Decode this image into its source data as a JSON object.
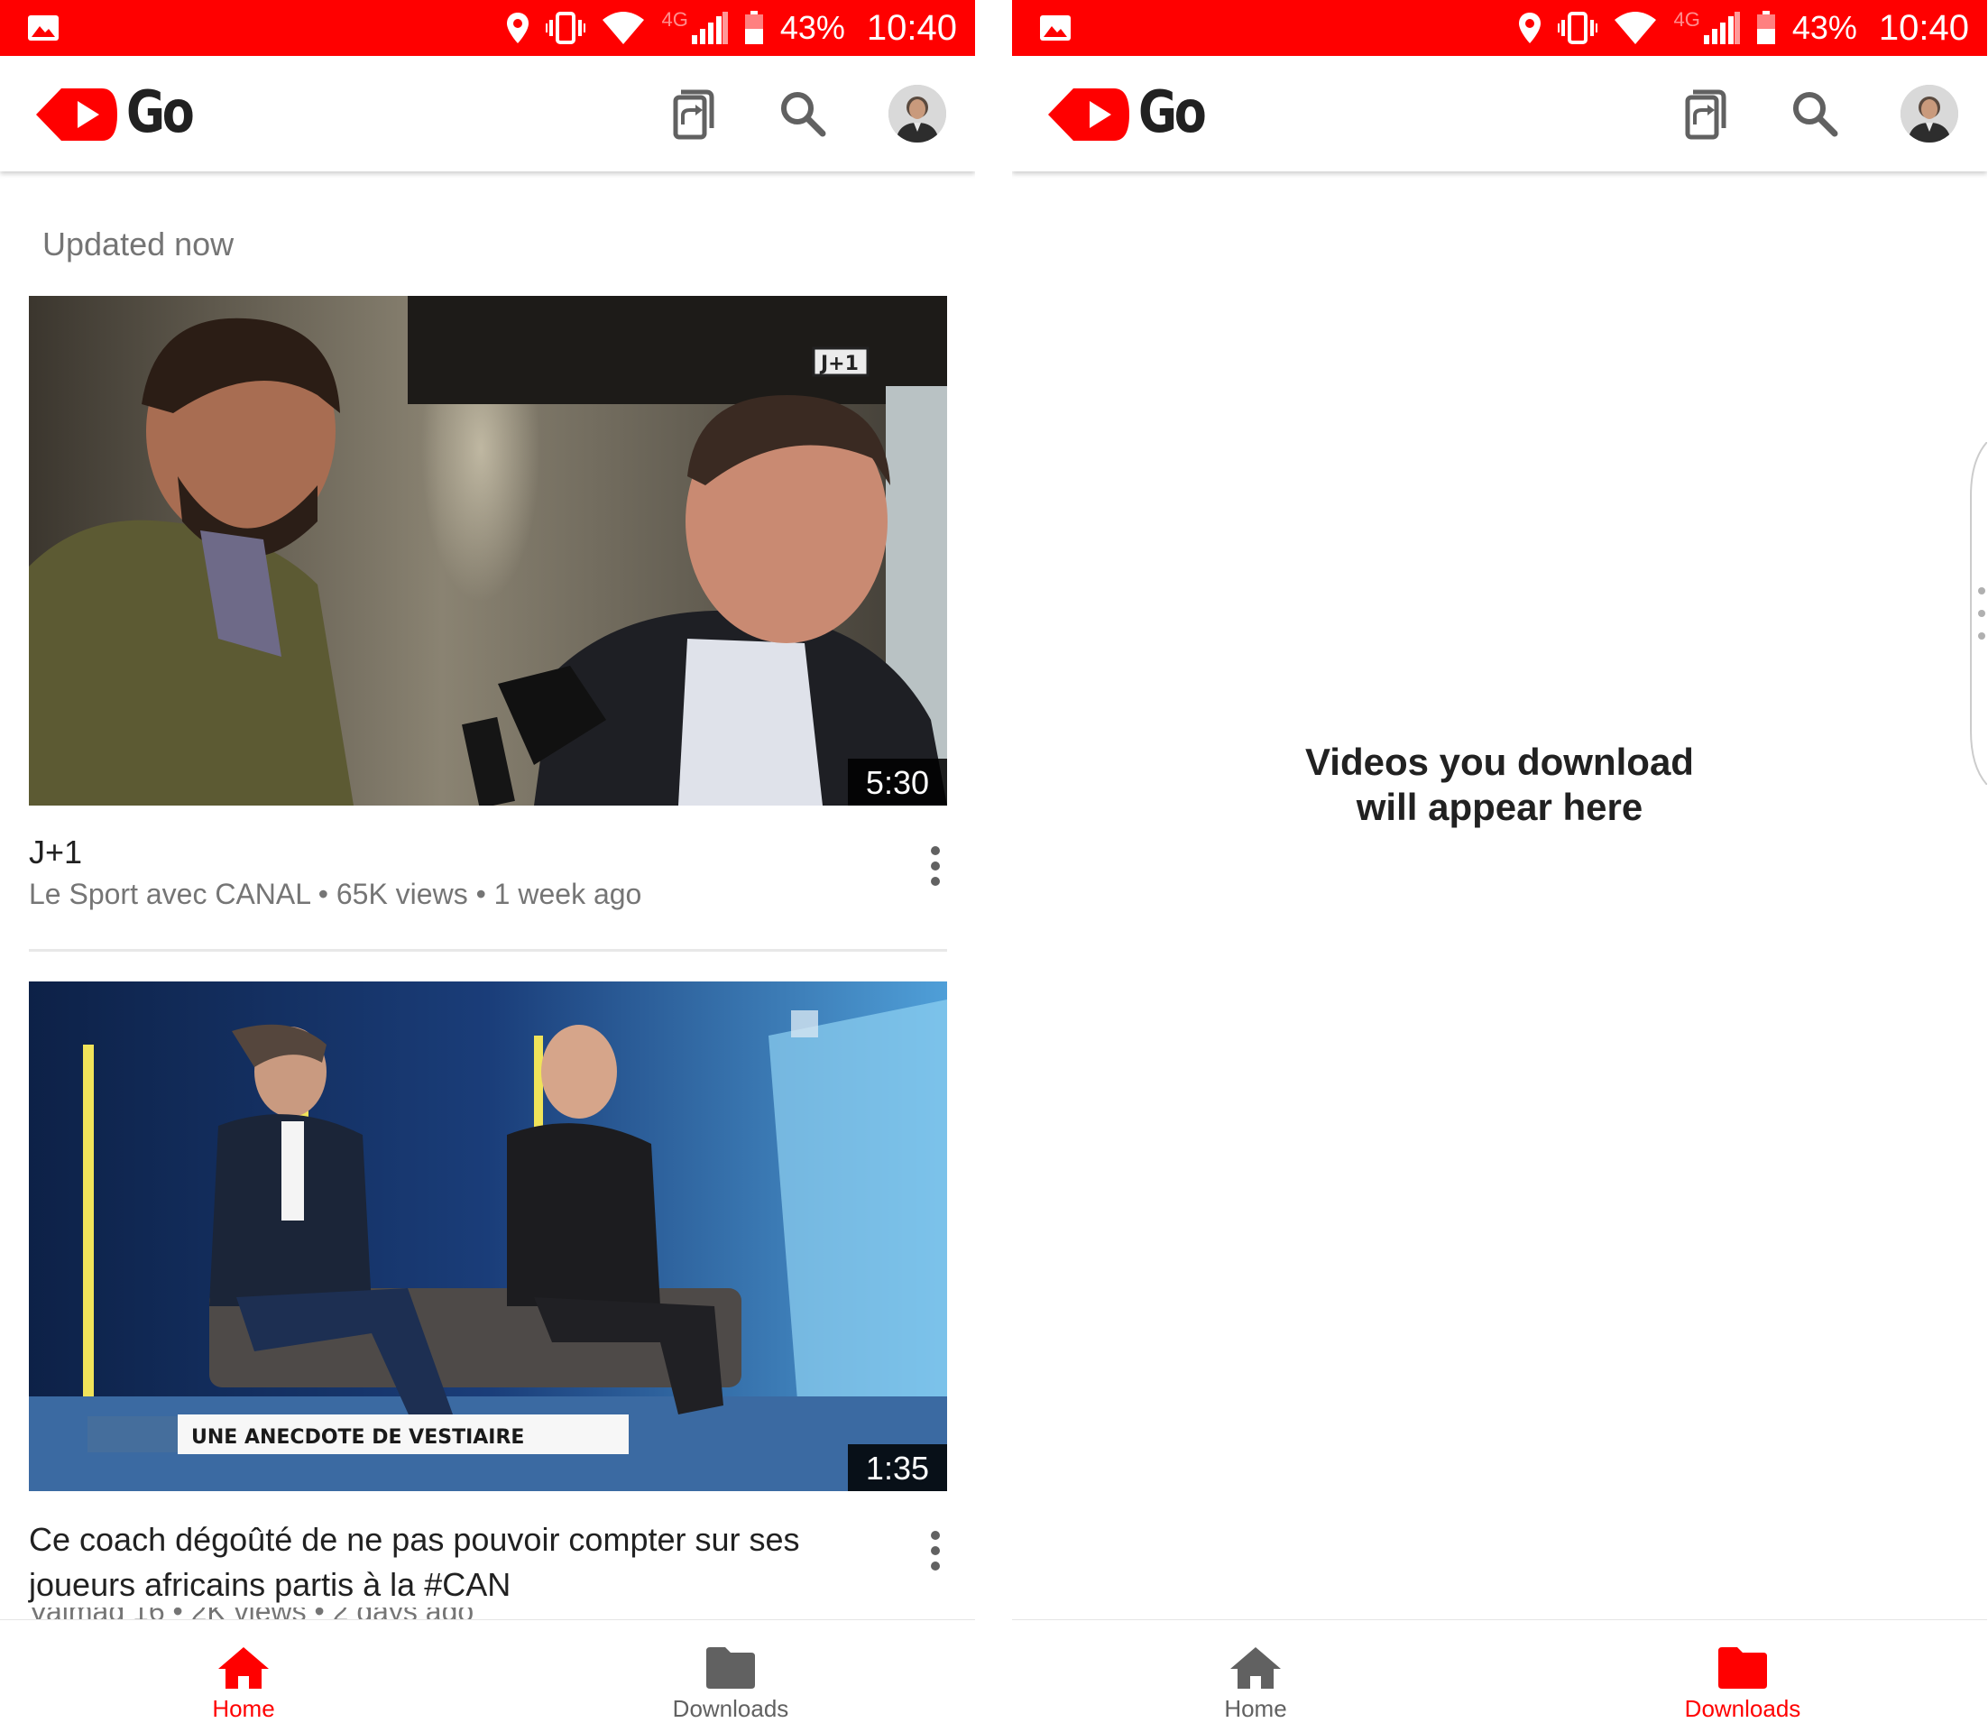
{
  "status_bar": {
    "network": "4G",
    "battery_percent": "43%",
    "time": "10:40"
  },
  "app": {
    "logo_text": "Go"
  },
  "home": {
    "updated_label": "Updated now",
    "videos": [
      {
        "title": "J+1",
        "meta": "Le Sport avec CANAL • 65K views • 1 week ago",
        "duration": "5:30"
      },
      {
        "title": "Ce coach dégoûté de ne pas pouvoir compter sur ses joueurs africains partis à la #CAN",
        "meta": "Valmag 16 • 2K views • 2 days ago",
        "duration": "1:35"
      }
    ]
  },
  "downloads": {
    "empty_line1": "Videos you download",
    "empty_line2": "will appear here"
  },
  "nav": {
    "home_label": "Home",
    "downloads_label": "Downloads"
  },
  "colors": {
    "brand_red": "#ff0000",
    "active_nav": "#ff0000",
    "inactive_nav": "#616161"
  }
}
